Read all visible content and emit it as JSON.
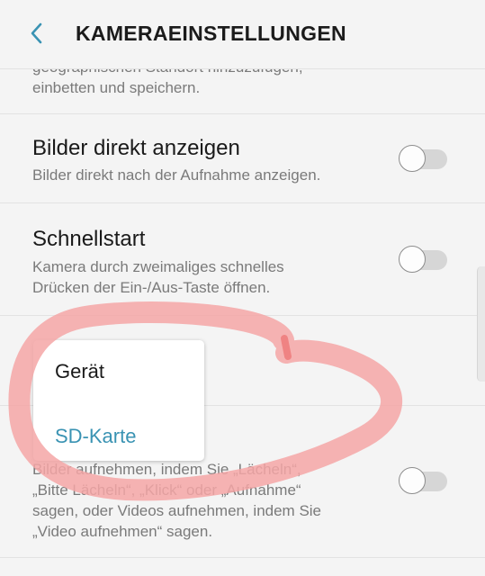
{
  "header": {
    "title": "KAMERAEINSTELLUNGEN"
  },
  "settings": [
    {
      "description_line1": "geographischen Standort hinzuzufügen,",
      "description_line2": "einbetten und speichern."
    },
    {
      "title": "Bilder direkt anzeigen",
      "description": "Bilder direkt nach der Aufnahme anzeigen.",
      "enabled": false
    },
    {
      "title": "Schnellstart",
      "description_line1": "Kamera durch zweimaliges schnelles",
      "description_line2": "Drücken der Ein-/Aus-Taste öffnen.",
      "enabled": false
    },
    {
      "description_line1": "Bilder aufnehmen, indem Sie „Lächeln“,",
      "description_line2": "„Bitte Lächeln“, „Klick“ oder „Aufnahme“",
      "description_line3": "sagen, oder Videos aufnehmen, indem Sie",
      "description_line4": "„Video aufnehmen“ sagen.",
      "enabled": false
    }
  ],
  "storage_popup": {
    "options": [
      "Gerät",
      "SD-Karte"
    ],
    "selected": "SD-Karte"
  },
  "colors": {
    "accent": "#3a93b3",
    "annotation": "#f4a6a6"
  }
}
